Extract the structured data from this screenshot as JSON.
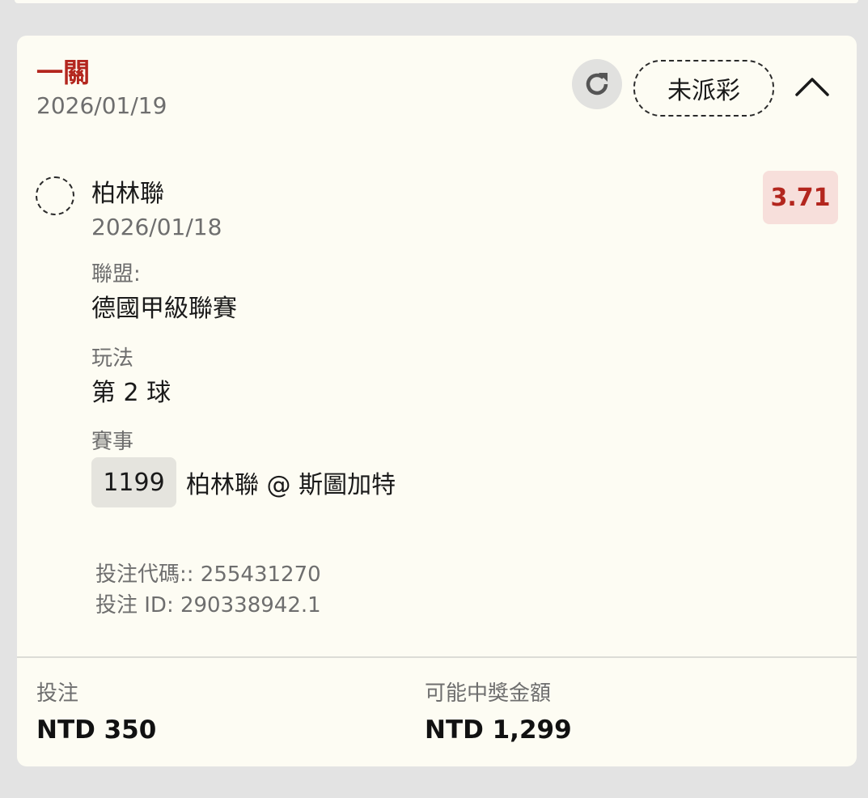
{
  "header": {
    "title": "一關",
    "date": "2026/01/19",
    "status": "未派彩"
  },
  "selection": {
    "name": "柏林聯",
    "date": "2026/01/18",
    "odds": "3.71"
  },
  "details": {
    "league_label": "聯盟:",
    "league_value": "德國甲級聯賽",
    "bet_type_label": "玩法",
    "bet_type_value": "第 2 球",
    "event_label": "賽事",
    "event_code": "1199",
    "event_name": "柏林聯 @ 斯圖加特"
  },
  "meta": {
    "bet_code": "投注代碼:: 255431270",
    "bet_id": "投注 ID: 290338942.1"
  },
  "footer": {
    "stake_label": "投注",
    "stake_value": "NTD 350",
    "payout_label": "可能中獎金額",
    "payout_value": "NTD 1,299"
  },
  "icons": {
    "refresh": "refresh-icon",
    "collapse": "chevron-up-icon"
  },
  "colors": {
    "accent": "#b3261e",
    "card_bg": "#fdfcf3",
    "page_bg": "#e3e3e3",
    "odds_bg": "#f7dfdb"
  }
}
